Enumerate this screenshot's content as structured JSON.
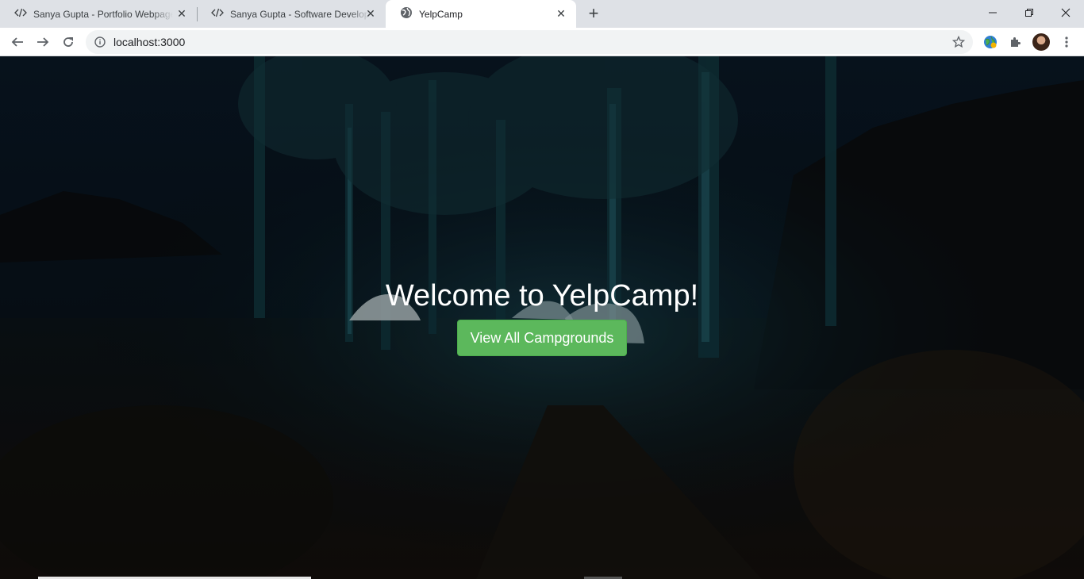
{
  "browser": {
    "tabs": [
      {
        "title": "Sanya Gupta - Portfolio Webpage",
        "icon": "code-icon",
        "active": false
      },
      {
        "title": "Sanya Gupta - Software Developer",
        "icon": "code-icon",
        "active": false
      },
      {
        "title": "YelpCamp",
        "icon": "globe-icon",
        "active": true
      }
    ],
    "new_tab_label": "+",
    "address": "localhost:3000"
  },
  "hero": {
    "title": "Welcome to YelpCamp!",
    "button_label": "View All Campgrounds"
  },
  "colors": {
    "button_bg": "#5cb85c",
    "tabstrip_bg": "#dee1e6",
    "page_bg": "#04080b"
  }
}
